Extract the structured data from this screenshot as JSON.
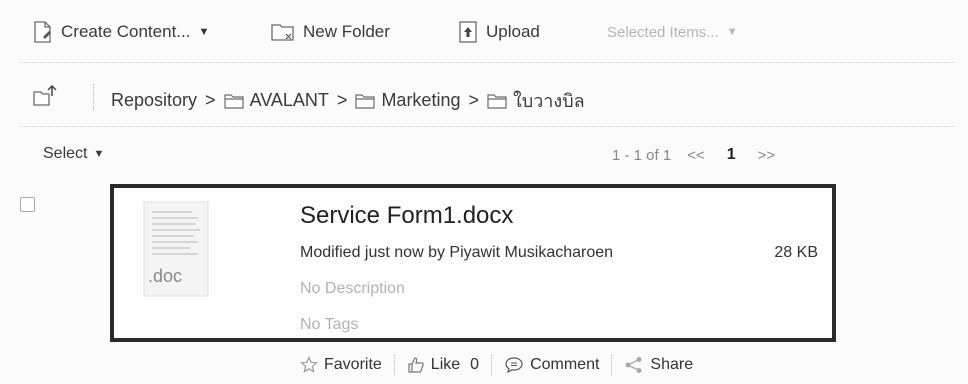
{
  "toolbar": {
    "create_content": "Create Content...",
    "new_folder": "New Folder",
    "upload": "Upload",
    "selected_items": "Selected Items..."
  },
  "breadcrumb": {
    "root": "Repository",
    "items": [
      "AVALANT",
      "Marketing",
      "ใบวางบิล"
    ],
    "separator": ">"
  },
  "list": {
    "select_label": "Select",
    "pager_summary": "1 - 1 of 1",
    "pager_prev": "<<",
    "pager_current": "1",
    "pager_next": ">>"
  },
  "document": {
    "thumb_label": ".doc",
    "name": "Service Form1.docx",
    "modified": "Modified just now by Piyawit Musikacharoen",
    "size": "28 KB",
    "description": "No Description",
    "tags": "No Tags",
    "actions": {
      "favorite": "Favorite",
      "like": "Like",
      "like_count": "0",
      "comment": "Comment",
      "share": "Share"
    }
  },
  "colors": {
    "card_border": "#2a2a2a",
    "muted_text": "#b3b3b3",
    "background": "#fbfbfb"
  }
}
